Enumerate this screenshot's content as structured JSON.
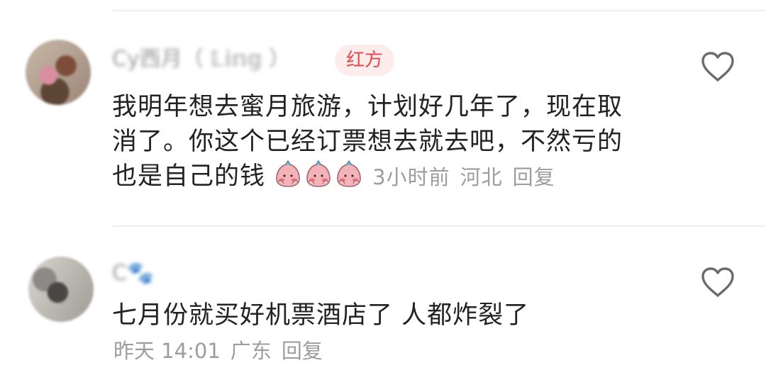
{
  "comments": [
    {
      "username": "Cy西月（ 𝕃𝕚𝕟𝕘 ）",
      "badge": "红方",
      "text_lines": [
        "我明年想去蜜月旅游，计划好几年了，现在取",
        "消了。你这个已经订票想去就去吧，不然亏的",
        "也是自己的钱"
      ],
      "emoji_count": 3,
      "time": "3小时前",
      "location": "河北",
      "reply": "回复",
      "like_icon": "heart-outline-icon"
    },
    {
      "username": "C🐾",
      "text": "七月份就买好机票酒店了 人都炸裂了",
      "time": "昨天 14:01",
      "location": "广东",
      "reply": "回复",
      "like_icon": "heart-outline-icon"
    }
  ],
  "colors": {
    "text": "#222222",
    "meta": "#9d9d9d",
    "badge_bg": "#fdecec",
    "badge_text": "#e24a4a",
    "divider": "#efefef",
    "heart": "#6b6b6b"
  }
}
